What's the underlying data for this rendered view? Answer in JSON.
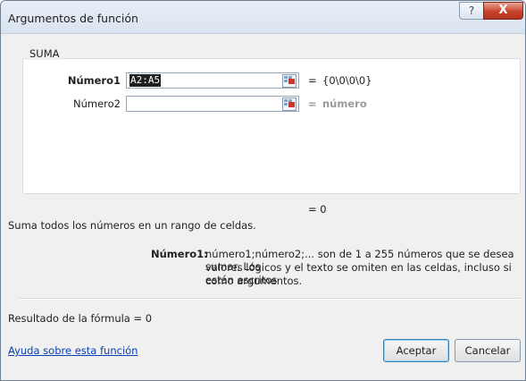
{
  "dialog": {
    "title": "Argumentos de función",
    "help_icon": "?",
    "close_icon": "X"
  },
  "function": {
    "name": "SUMA",
    "args": [
      {
        "label": "Número1",
        "value": "A2:A5",
        "result": "{0\\0\\0\\0}"
      },
      {
        "label": "Número2",
        "value": "",
        "result": "número"
      }
    ],
    "result_line": "= 0"
  },
  "description": {
    "summary": "Suma todos los números en un rango de celdas.",
    "arg_label": "Número1:",
    "arg_text_line1": "número1;número2;... son de 1 a 255 números que se desea sumar. Los",
    "arg_text_line2": "valores lógicos y el texto se omiten en las celdas, incluso si están escritos",
    "arg_text_line3": "como argumentos."
  },
  "formula_result": "Resultado de la fórmula =  0",
  "help_link": "Ayuda sobre esta función",
  "buttons": {
    "ok": "Aceptar",
    "cancel": "Cancelar"
  },
  "icons": {
    "collapse_dialog": "collapse-dialog-icon",
    "help": "help-icon",
    "close": "close-icon"
  },
  "colors": {
    "link": "#0a3fb6",
    "close_button": "#c7422b",
    "hint_text": "#9a9a9a"
  }
}
